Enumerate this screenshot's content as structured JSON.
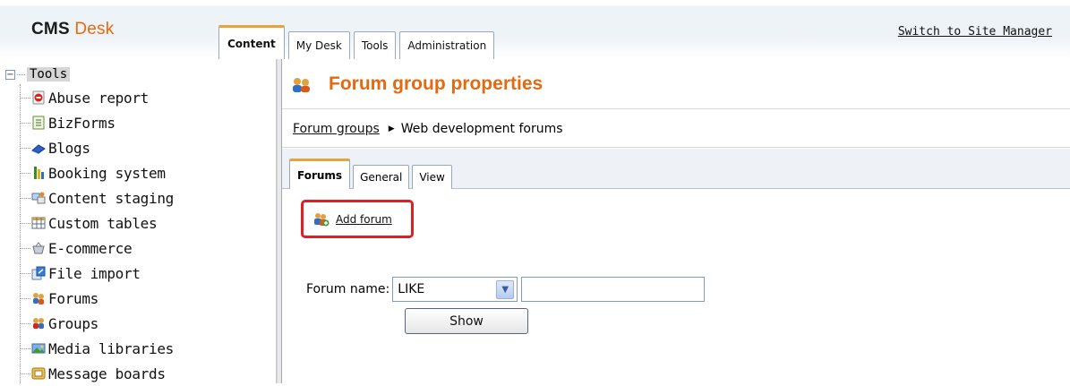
{
  "app": {
    "logo_cms": "CMS",
    "logo_desk": "Desk",
    "switch_link": "Switch to Site Manager"
  },
  "top_tabs": [
    {
      "label": "Content",
      "active": true
    },
    {
      "label": "My Desk",
      "active": false
    },
    {
      "label": "Tools",
      "active": false
    },
    {
      "label": "Administration",
      "active": false
    }
  ],
  "tree": {
    "root_toggle": "−",
    "root_label": "Tools",
    "items": [
      {
        "label": "Abuse report",
        "icon": "abuse-report-icon"
      },
      {
        "label": "BizForms",
        "icon": "bizforms-icon"
      },
      {
        "label": "Blogs",
        "icon": "blogs-icon"
      },
      {
        "label": "Booking system",
        "icon": "booking-system-icon"
      },
      {
        "label": "Content staging",
        "icon": "content-staging-icon"
      },
      {
        "label": "Custom tables",
        "icon": "custom-tables-icon"
      },
      {
        "label": "E-commerce",
        "icon": "e-commerce-icon"
      },
      {
        "label": "File import",
        "icon": "file-import-icon"
      },
      {
        "label": "Forums",
        "icon": "forums-icon"
      },
      {
        "label": "Groups",
        "icon": "groups-icon"
      },
      {
        "label": "Media libraries",
        "icon": "media-libraries-icon"
      },
      {
        "label": "Message boards",
        "icon": "message-boards-icon"
      }
    ]
  },
  "content": {
    "title": "Forum group properties",
    "breadcrumb": {
      "link": "Forum groups",
      "current": "Web development forums"
    },
    "sub_tabs": [
      {
        "label": "Forums",
        "active": true
      },
      {
        "label": "General",
        "active": false
      },
      {
        "label": "View",
        "active": false
      }
    ],
    "action": {
      "label": "Add forum"
    },
    "filter": {
      "label": "Forum name:",
      "operator": "LIKE",
      "value": "",
      "button": "Show"
    }
  },
  "colors": {
    "accent_orange": "#e26a13",
    "tab_highlight": "#e8a33a",
    "highlight_box": "#dd1f26"
  }
}
